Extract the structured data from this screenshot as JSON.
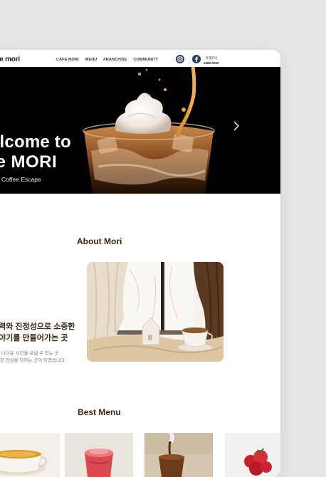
{
  "header": {
    "logo": "fe mori",
    "nav": [
      "CAFE MORI",
      "MENU",
      "FRANCHISE",
      "COMMUNITY"
    ],
    "franchise_label": "가맹문의",
    "franchise_phone": "1688-0000",
    "social_icons": [
      "instagram-icon",
      "facebook-icon"
    ]
  },
  "hero": {
    "title_line1": "elcome to",
    "title_line2": "fe MORI",
    "subtitle": "fect Coffee Escape",
    "next_icon": "chevron-right-icon"
  },
  "about": {
    "title": "About Mori",
    "heading_line1": "매력와 진정성으로 소중한",
    "heading_line2": "이야기를 만들어가는 곳",
    "body_line1": "가장 나다운 시간을 보낼 수 있는 곳",
    "body_line2": "소중한 진심을 다하는 곳이 되겠습니다"
  },
  "best_menu": {
    "title": "Best Menu",
    "items": [
      "tea-cup",
      "strawberry-drink",
      "coffee-pour",
      "strawberries"
    ]
  },
  "colors": {
    "accent_brown": "#3a2614",
    "social_navy": "#2f3d5e",
    "page_bg": "#e6e6e6"
  }
}
